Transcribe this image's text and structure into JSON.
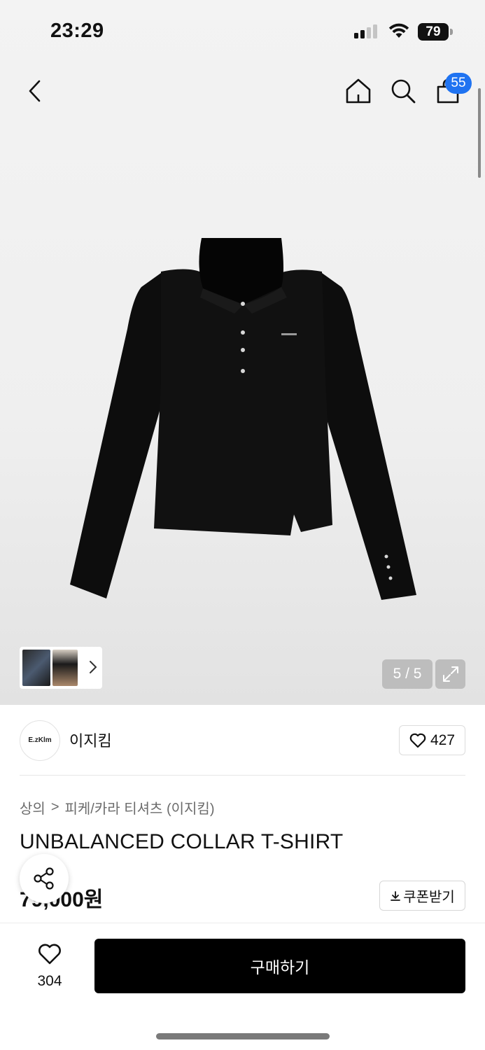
{
  "status_bar": {
    "time": "23:29",
    "battery_level": "79"
  },
  "nav": {
    "cart_count": "55",
    "icons": [
      "chevron-left-icon",
      "home-icon",
      "search-icon",
      "shopping-bag-icon"
    ]
  },
  "gallery": {
    "counter": "5 / 5"
  },
  "brand": {
    "logo_text": "E.zKlm",
    "name": "이지킴",
    "like_count": "427"
  },
  "breadcrumb": {
    "level1": "상의",
    "separator": ">",
    "level2": "피케/카라 티셔츠 (이지킴)"
  },
  "product": {
    "title": "UNBALANCED COLLAR T-SHIRT",
    "price": "79,000원",
    "coupon_label": "쿠폰받기"
  },
  "bottom_bar": {
    "wish_count": "304",
    "buy_label": "구매하기"
  },
  "colors": {
    "accent_blue": "#1f73f1",
    "buy_button": "#000000"
  }
}
